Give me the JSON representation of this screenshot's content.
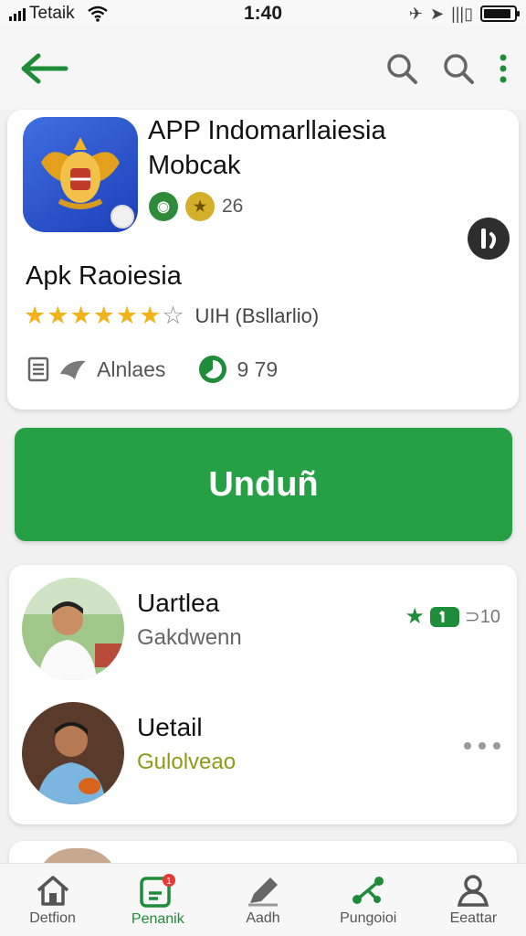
{
  "status_bar": {
    "carrier": "Tetaik",
    "time": "1:40",
    "battery_level": 0.9
  },
  "app": {
    "title_line1": "APP Indomarllaiesia",
    "title_line2": "Mobcak",
    "developer_count": "26",
    "apk_name": "Apk Raoiesia",
    "rating_stars": 6,
    "rating_total": 7,
    "rating_text": "UIH (Bsllarlio)",
    "meta_label": "Alnlaes",
    "meta_value": "9 79"
  },
  "install_button": {
    "label": "Unduñ"
  },
  "reviewers": [
    {
      "name": "Uartlea",
      "subtitle": "Gakdwenn",
      "score": "⊃10"
    },
    {
      "name": "Uetail",
      "subtitle": "Gulolveao"
    }
  ],
  "bottom_nav": {
    "items": [
      {
        "label": "Detfion",
        "icon": "home-icon"
      },
      {
        "label": "Penanik",
        "icon": "app-badge-icon",
        "active": true
      },
      {
        "label": "Aadh",
        "icon": "edit-icon"
      },
      {
        "label": "Pungoioi",
        "icon": "share-icon"
      },
      {
        "label": "Eeattar",
        "icon": "person-icon"
      }
    ]
  },
  "colors": {
    "accent": "#25a044",
    "star": "#f2b21a",
    "dark_green": "#1f8c3a"
  }
}
